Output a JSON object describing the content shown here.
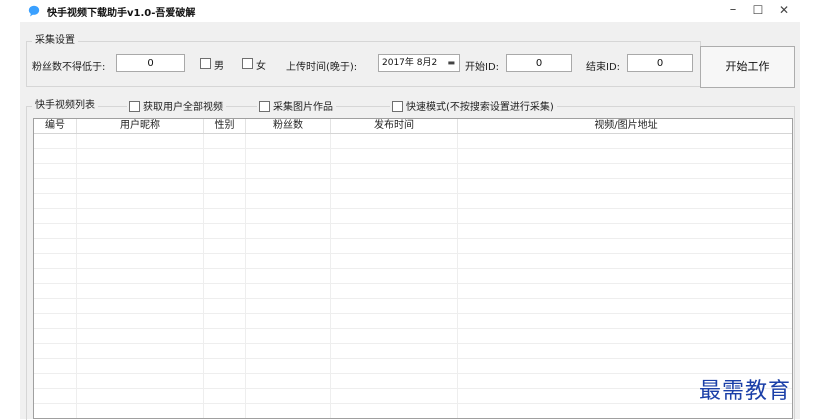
{
  "window": {
    "title": "快手视频下载助手v1.0-吾爱破解",
    "controls": {
      "minimize": "–",
      "maximize": "☐",
      "close": "✕"
    }
  },
  "collect_settings": {
    "legend": "采集设置",
    "min_fans_label": "粉丝数不得低于:",
    "min_fans_value": "0",
    "gender_male_label": "男",
    "gender_female_label": "女",
    "male_checked": false,
    "female_checked": false,
    "upload_time_label": "上传时间(晚于):",
    "upload_time_value": "2017年 8月2",
    "start_id_label": "开始ID:",
    "start_id_value": "0",
    "end_id_label": "结束ID:",
    "end_id_value": "0",
    "start_button": "开始工作"
  },
  "video_list": {
    "legend": "快手视频列表",
    "options": [
      {
        "label": "获取用户全部视频",
        "checked": false
      },
      {
        "label": "采集图片作品",
        "checked": false
      },
      {
        "label": "快速模式(不按搜索设置进行采集)",
        "checked": false
      }
    ],
    "columns": [
      "编号",
      "用户昵称",
      "性别",
      "粉丝数",
      "发布时间",
      "视频/图片地址"
    ],
    "rows": []
  },
  "watermark": "最需教育",
  "colors": {
    "window_bg": "#f0f0f0",
    "watermark": "#1a3fa8",
    "app_icon": "#3aa0ff"
  },
  "icons": {
    "app": "bubble-icon"
  }
}
